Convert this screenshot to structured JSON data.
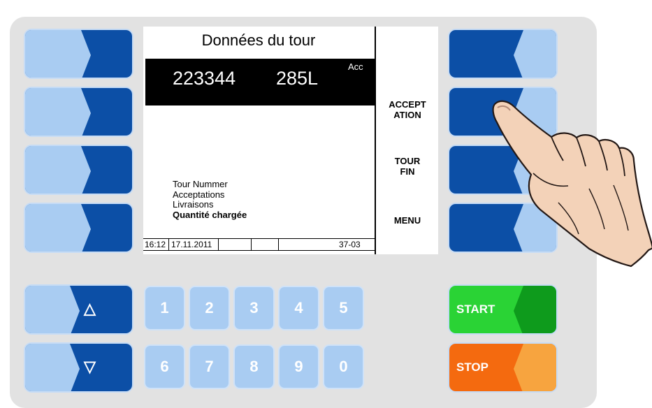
{
  "screen": {
    "title": "Données du tour",
    "tour_number": "223344",
    "volume": "285L",
    "bar_label": "Acc",
    "info_lines": [
      "Tour Nummer",
      "Acceptations",
      "Livraisons"
    ],
    "info_bold": "Quantité chargée",
    "status": {
      "time": "16:12",
      "date": "17.11.2011",
      "code": "37-03"
    },
    "softkey_labels": {
      "acceptation": [
        "ACCEPT",
        "ATION"
      ],
      "tour_fin": [
        "TOUR",
        "FIN"
      ],
      "menu": "MENU"
    }
  },
  "numpad": {
    "keys": [
      "1",
      "2",
      "3",
      "4",
      "5",
      "6",
      "7",
      "8",
      "9",
      "0"
    ]
  },
  "controls": {
    "start": "START",
    "stop": "STOP",
    "up_icon": "△",
    "down_icon": "▽"
  },
  "colors": {
    "key_dark": "#0c4fa6",
    "key_light": "#a9ccf2",
    "start_green": "#1fc52c",
    "stop_orange": "#f46a0f"
  }
}
